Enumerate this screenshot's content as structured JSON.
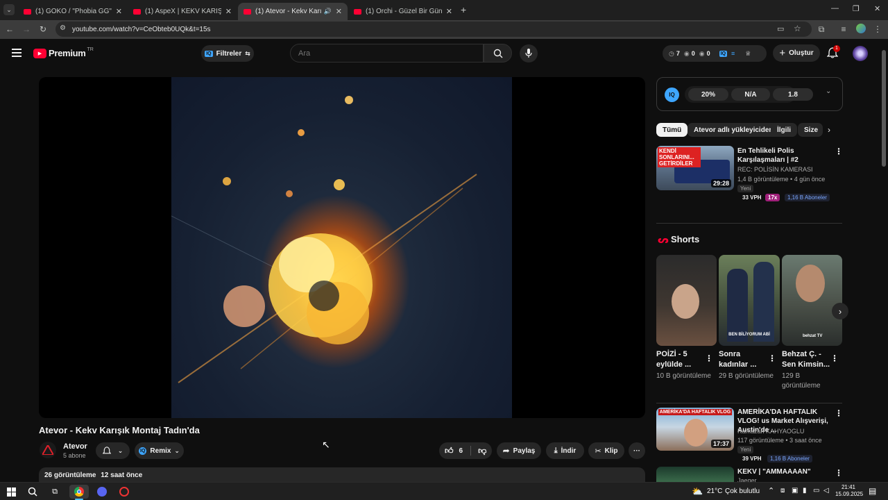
{
  "browser": {
    "tabs": [
      {
        "title": "(1) GOKO / \"Phobia GG\" / GUN",
        "active": false
      },
      {
        "title": "(1) AspeX | KEKV KARIŞIK MONTAJ",
        "active": false
      },
      {
        "title": "(1) Atevor - Kekv Karışık Montaj",
        "active": true
      },
      {
        "title": "(1) Orchi - Güzel Bir Gün Görme",
        "active": false
      }
    ],
    "url": "youtube.com/watch?v=CeObteb0UQk&t=15s"
  },
  "header": {
    "logo": "Premium",
    "region": "TR",
    "filters_label": "Filtreler",
    "search_placeholder": "Ara",
    "stats": {
      "a": "7",
      "b": "0",
      "c": "0"
    },
    "create_label": "Oluştur",
    "notif_count": "1"
  },
  "iq_panel": {
    "iq": "IQ",
    "v1": "20%",
    "v2": "N/A",
    "v3": "1.8"
  },
  "chips": [
    "Tümü",
    "Atevor adlı yükleyiciden",
    "İlgili",
    "Size"
  ],
  "related": [
    {
      "title": "En Tehlikeli Polis Karşılaşmaları | #2",
      "channel": "REC: POLİSİN KAMERASI",
      "views": "1,4 B görüntüleme",
      "age": "4 gün önce",
      "new": "Yeni",
      "duration": "29:28",
      "vph": "33 VPH",
      "mult": "17x",
      "subs": "1,16 B Aboneler",
      "thumb_text": "KENDİ SONLARINI... GETİRDİLER"
    },
    {
      "title": "AMERİKA'DA HAFTALIK VLOG! us Market Alışverişi, Austin'de ...",
      "channel": "Ramazan KAHYAOGLU",
      "views": "117 görüntüleme",
      "age": "3 saat önce",
      "new": "Yeni",
      "duration": "17:37",
      "vph": "39 VPH",
      "subs": "1,16 B Aboneler",
      "thumb_text": "AMERİKA'DA HAFTALIK VLOG"
    },
    {
      "title": "KEKV | \"AMMAAAAN\"",
      "channel": "Jaeger"
    }
  ],
  "shorts": {
    "heading": "Shorts",
    "items": [
      {
        "title": "POİZİ - 5 eylülde ...",
        "views": "10 B görüntüleme"
      },
      {
        "title": "Sonra kadınlar ...",
        "views": "29 B görüntüleme",
        "thumb_text": "BEN BİLİYORUM ABİ"
      },
      {
        "title": "Behzat Ç. - Sen Kimsin...",
        "views": "129 B görüntüleme",
        "thumb_text": "behzat TV"
      }
    ]
  },
  "video": {
    "title": "Atevor - Kekv Karışık Montaj Tadın'da",
    "channel": "Atevor",
    "subs": "5 abone",
    "remix": "Remix",
    "likes": "6",
    "share": "Paylaş",
    "download": "İndir",
    "clip": "Klip",
    "views": "26 görüntüleme",
    "age": "12 saat önce"
  },
  "taskbar": {
    "weather": "21°C",
    "weather_desc": "Çok bulutlu",
    "time": "21:41",
    "date": "15.09.2025"
  },
  "colors": {
    "accent": "#ff0033",
    "iq": "#3ea6ff",
    "bg": "#0f0f0f"
  }
}
